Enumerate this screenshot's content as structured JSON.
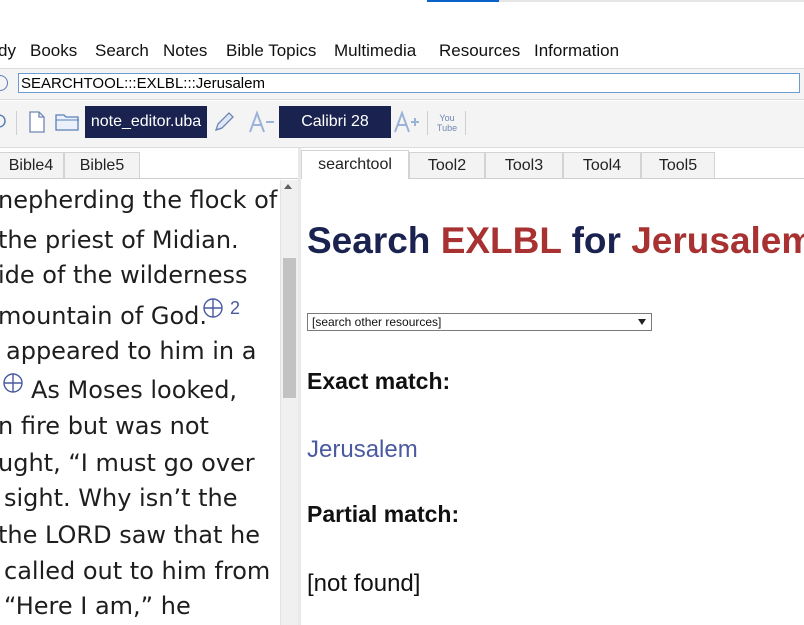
{
  "menubar": {
    "items": [
      "dy",
      "Books",
      "Search",
      "Notes",
      "Bible Topics",
      "Multimedia",
      "Resources",
      "Information"
    ]
  },
  "command": {
    "value": "SEARCHTOOL:::EXLBL:::Jerusalem"
  },
  "toolbar": {
    "file_label": "note_editor.uba",
    "font_label": "Calibri 28",
    "youtube_label": "You Tube",
    "icons": [
      "refresh-icon",
      "new-file-icon",
      "open-folder-icon",
      "edit-pencil-icon",
      "decrease-font-icon",
      "increase-font-icon",
      "youtube-icon"
    ]
  },
  "left_tabs": [
    "Bible4",
    "Bible5"
  ],
  "right_tabs": [
    "searchtool",
    "Tool2",
    "Tool3",
    "Tool4",
    "Tool5"
  ],
  "bible_text": {
    "lines": [
      "nepherding the flock of",
      "the priest of Midian.",
      "ide of the wilderness",
      "mountain of God.",
      "appeared to him in a",
      "As Moses looked,",
      "n fire but was not",
      "ught, “I must go over",
      "sight. Why isn’t the",
      "the LORD saw that he",
      "called out to him from",
      "“Here I am,” he"
    ],
    "verse_marker": "2"
  },
  "search": {
    "heading_prefix": "Search",
    "heading_module": "EXLBL",
    "heading_for": "for",
    "heading_term": "Jerusalem",
    "select_value": "[search other resources]",
    "exact_heading": "Exact match:",
    "exact_results": [
      "Jerusalem"
    ],
    "partial_heading": "Partial match:",
    "partial_result": "[not found]"
  },
  "colors": {
    "accent_dark": "#1a2350",
    "highlight_red": "#a83232",
    "link_blue": "#4a5aa0",
    "input_border": "#6a9bd3"
  }
}
